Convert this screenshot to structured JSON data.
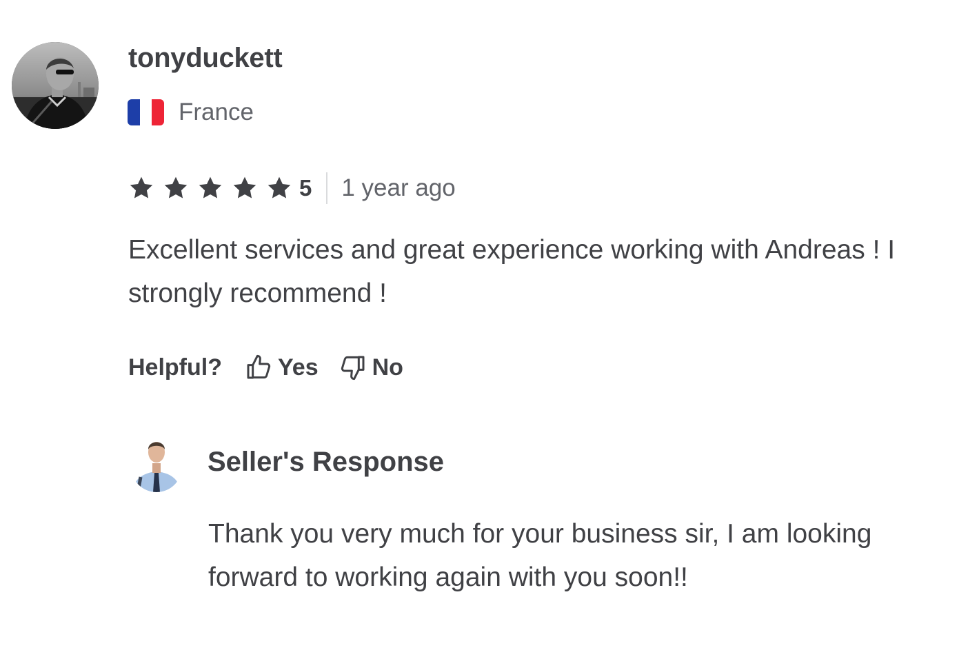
{
  "review": {
    "username": "tonyduckett",
    "country": "France",
    "flag": {
      "colors": [
        "#1d3ea8",
        "#ffffff",
        "#ee2436"
      ]
    },
    "rating": {
      "stars": 5,
      "max": 5,
      "label": "5"
    },
    "time_ago": "1 year ago",
    "text": "Excellent services and great experience working with Andreas ! I strongly recommend !",
    "helpful": {
      "label": "Helpful?",
      "yes_label": "Yes",
      "no_label": "No"
    }
  },
  "seller_response": {
    "title": "Seller's Response",
    "text": "Thank you very much for your business sir, I am looking forward to working again with you soon!!"
  },
  "colors": {
    "text_primary": "#404145",
    "text_secondary": "#62646a",
    "star": "#404145",
    "divider": "#dadbdd"
  }
}
